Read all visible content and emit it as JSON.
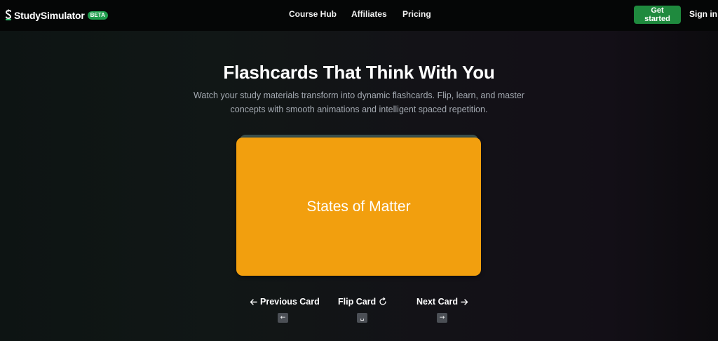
{
  "nav": {
    "brand_name": "StudySimulator",
    "beta_label": "BETA",
    "links": {
      "course_hub": "Course Hub",
      "affiliates": "Affiliates",
      "pricing": "Pricing"
    },
    "get_started_label": "Get started",
    "sign_in_label": "Sign in"
  },
  "hero": {
    "title": "Flashcards That Think With You",
    "subtitle": "Watch your study materials transform into dynamic flashcards. Flip, learn, and master concepts with smooth animations and intelligent spaced repetition."
  },
  "flashcard": {
    "front_text": "States of Matter",
    "color": "#f29f0e"
  },
  "controls": {
    "previous_label": "Previous Card",
    "flip_label": "Flip Card",
    "next_label": "Next Card",
    "previous_icon": "arrow-left-icon",
    "flip_icon": "rotate-icon",
    "next_icon": "arrow-right-icon",
    "previous_key": "←",
    "flip_key": "␣",
    "next_key": "→"
  },
  "colors": {
    "accent_green": "#1f8a3e",
    "beta_green": "#1f9d4d",
    "card_orange": "#f29f0e"
  }
}
